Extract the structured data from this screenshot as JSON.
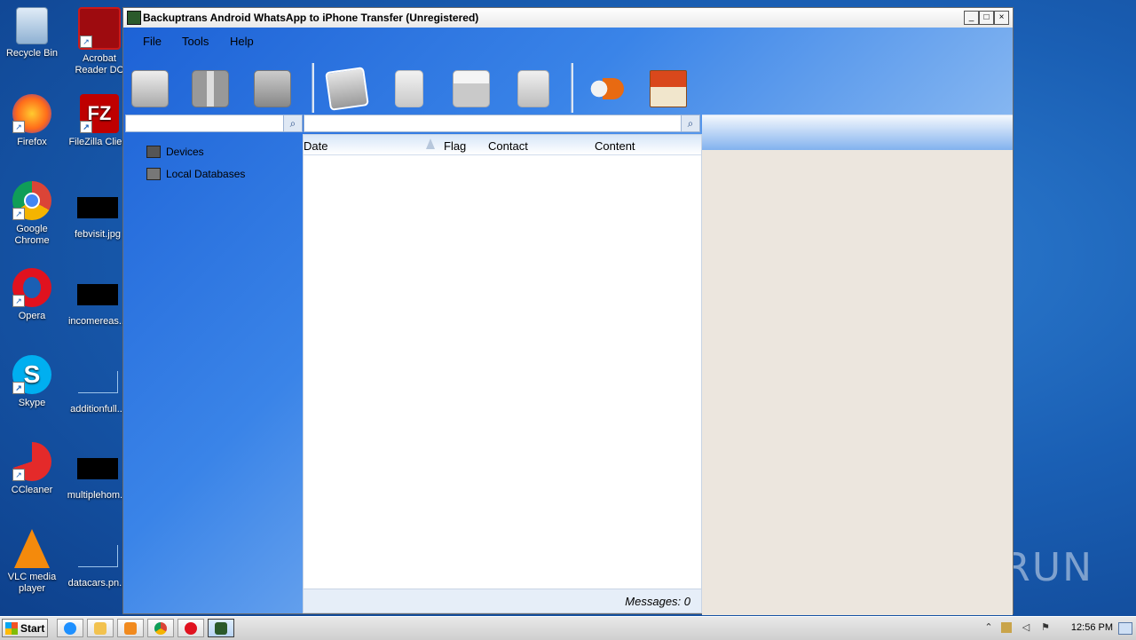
{
  "desktop": {
    "icons": [
      {
        "label": "Recycle Bin"
      },
      {
        "label": "Acrobat Reader DC"
      },
      {
        "label": "Firefox"
      },
      {
        "label": "FileZilla Client"
      },
      {
        "label": "Google Chrome"
      },
      {
        "label": "febvisit.jpg"
      },
      {
        "label": "Opera"
      },
      {
        "label": "incomereas..."
      },
      {
        "label": "Skype"
      },
      {
        "label": "additionfull..."
      },
      {
        "label": "CCleaner"
      },
      {
        "label": "multiplehom..."
      },
      {
        "label": "VLC media player"
      },
      {
        "label": "datacars.pn..."
      }
    ],
    "watermark": "ANY RUN"
  },
  "window": {
    "title": "Backuptrans Android WhatsApp to iPhone Transfer (Unregistered)",
    "controls": {
      "minimize": "_",
      "maximize": "□",
      "close": "×"
    }
  },
  "menu": {
    "file": "File",
    "tools": "Tools",
    "help": "Help"
  },
  "toolbar": {
    "buttons": [
      {
        "icon": "backup-to-database-icon"
      },
      {
        "icon": "transfer-android-to-iphone-icon"
      },
      {
        "icon": "database-to-phone-icon"
      },
      {
        "icon": "export-photos-icon"
      },
      {
        "icon": "export-document-icon"
      },
      {
        "icon": "print-icon"
      },
      {
        "icon": "recycle-bin-icon"
      },
      {
        "icon": "register-key-icon"
      },
      {
        "icon": "home-icon"
      }
    ]
  },
  "tree": {
    "devices": "Devices",
    "local_databases": "Local Databases"
  },
  "messages": {
    "columns": {
      "date": "Date",
      "flag": "Flag",
      "contact": "Contact",
      "content": "Content"
    },
    "count_label": "Messages: 0"
  },
  "taskbar": {
    "start_label": "Start",
    "clock": "12:56 PM"
  },
  "colors": {
    "desktop_blue": "#1a5fb4",
    "panel_beige": "#ece6de"
  }
}
